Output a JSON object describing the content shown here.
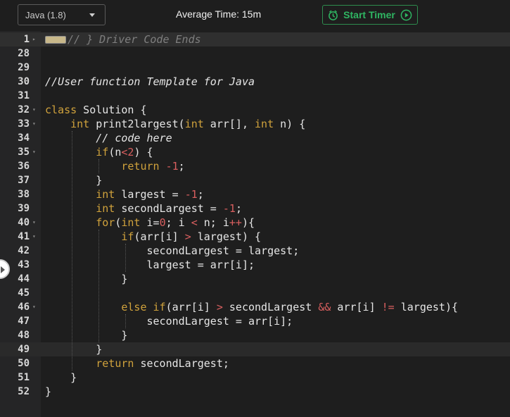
{
  "toolbar": {
    "language": "Java (1.8)",
    "average_time": "Average Time: 15m",
    "start_timer": "Start Timer"
  },
  "editor": {
    "lines": [
      {
        "num": "1",
        "code": "// } Driver Code Ends"
      },
      {
        "num": "28",
        "code": ""
      },
      {
        "num": "29",
        "code": ""
      },
      {
        "num": "30",
        "code": "//User function Template for Java"
      },
      {
        "num": "31",
        "code": ""
      },
      {
        "num": "32",
        "code": "class Solution {"
      },
      {
        "num": "33",
        "code": "    int print2largest(int arr[], int n) {"
      },
      {
        "num": "34",
        "code": "        // code here"
      },
      {
        "num": "35",
        "code": "        if(n<2) {"
      },
      {
        "num": "36",
        "code": "            return -1;"
      },
      {
        "num": "37",
        "code": "        }"
      },
      {
        "num": "38",
        "code": "        int largest = -1;"
      },
      {
        "num": "39",
        "code": "        int secondLargest = -1;"
      },
      {
        "num": "40",
        "code": "        for(int i=0; i < n; i++){"
      },
      {
        "num": "41",
        "code": "            if(arr[i] > largest) {"
      },
      {
        "num": "42",
        "code": "                secondLargest = largest;"
      },
      {
        "num": "43",
        "code": "                largest = arr[i];"
      },
      {
        "num": "44",
        "code": "            }"
      },
      {
        "num": "45",
        "code": ""
      },
      {
        "num": "46",
        "code": "            else if(arr[i] > secondLargest && arr[i] != largest){"
      },
      {
        "num": "47",
        "code": "                secondLargest = arr[i];"
      },
      {
        "num": "48",
        "code": "            }"
      },
      {
        "num": "49",
        "code": "        }"
      },
      {
        "num": "50",
        "code": "        return secondLargest;"
      },
      {
        "num": "51",
        "code": "    }"
      },
      {
        "num": "52",
        "code": "}"
      }
    ]
  },
  "colors": {
    "accent_green": "#2fb562",
    "keyword": "#d0a23c",
    "number": "#d95f5f",
    "comment": "#7f7f7f"
  }
}
